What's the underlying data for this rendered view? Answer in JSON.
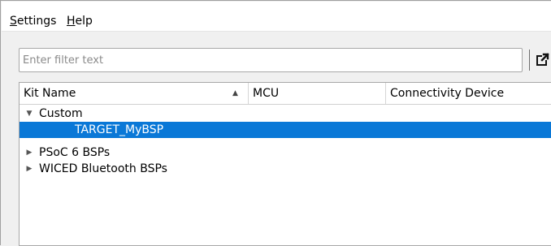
{
  "menubar": {
    "items": [
      {
        "label": "Settings"
      },
      {
        "label": "Help"
      }
    ]
  },
  "filter": {
    "placeholder": "Enter filter text",
    "value": ""
  },
  "toolbar": {
    "icon": "export-icon"
  },
  "tree": {
    "columns": [
      {
        "label": "Kit Name",
        "sorted": "ascending"
      },
      {
        "label": "MCU"
      },
      {
        "label": "Connectivity Device"
      }
    ],
    "rows": [
      {
        "label": "Custom",
        "expanded": true,
        "level": 0
      },
      {
        "label": "TARGET_MyBSP",
        "selected": true,
        "level": 1
      },
      {
        "label": "PSoC 6 BSPs",
        "expanded": false,
        "level": 0
      },
      {
        "label": "WICED Bluetooth BSPs",
        "expanded": false,
        "level": 0
      }
    ]
  },
  "colors": {
    "selection": "#0a78d7",
    "window_bg": "#f0f0f0",
    "border": "#a8a8a8"
  }
}
